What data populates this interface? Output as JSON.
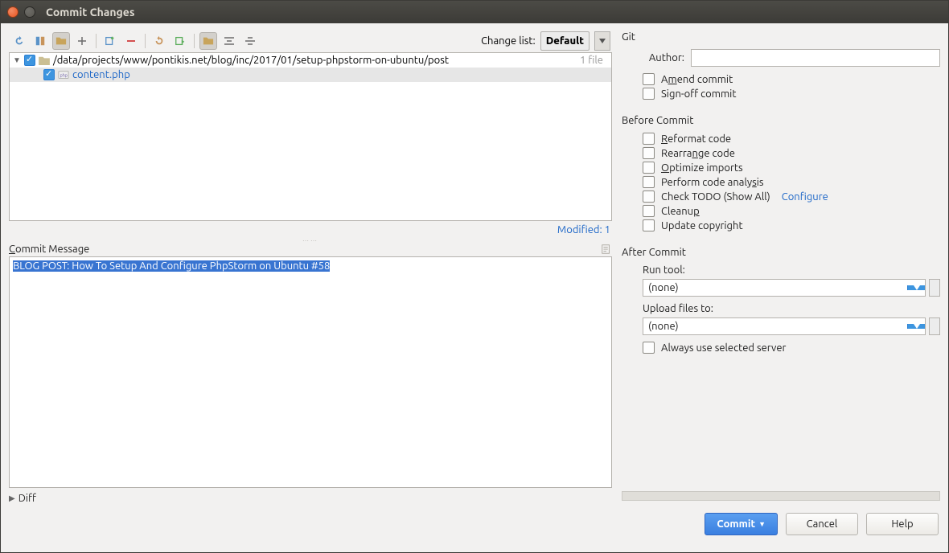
{
  "window": {
    "title": "Commit Changes"
  },
  "toolbar": {
    "change_list_label": "Change list:",
    "change_list_value": "Default"
  },
  "tree": {
    "path": "/data/projects/www/pontikis.net/blog/inc/2017/01/setup-phpstorm-on-ubuntu/post",
    "file_count": "1 file",
    "items": [
      {
        "name": "content.php",
        "checked": true
      }
    ]
  },
  "modified_label": "Modified: 1",
  "commit_message_label_pre": "C",
  "commit_message_label_rest": "ommit Message",
  "commit_message": "BLOG POST: How To Setup And Configure PhpStorm on Ubuntu #58",
  "diff_label": "Diff",
  "git": {
    "title": "Git",
    "author_label": "Author:",
    "author_value": "",
    "amend_label_pre": "A",
    "amend_label_mid": "m",
    "amend_label_rest": "end commit",
    "signoff_label": "Sign-off commit"
  },
  "before": {
    "title": "Before Commit",
    "items": [
      {
        "key": "reformat",
        "html": "<u>R</u>eformat code"
      },
      {
        "key": "rearrange",
        "html": "Rearra<u>n</u>ge code"
      },
      {
        "key": "optimize",
        "html": "<u>O</u>ptimize imports"
      },
      {
        "key": "analysis",
        "html": "Perform code analy<u>s</u>is"
      },
      {
        "key": "todo",
        "html": "Check TODO (Show All)",
        "link": "Configure"
      },
      {
        "key": "cleanup",
        "html": "Cleanu<u>p</u>"
      },
      {
        "key": "copyright",
        "html": "Update copyright"
      }
    ]
  },
  "after": {
    "title": "After Commit",
    "run_tool_label": "Run tool:",
    "run_tool_value": "(none)",
    "upload_label": "Upload files to:",
    "upload_value": "(none)",
    "always_label": "Always use selected server"
  },
  "buttons": {
    "commit": "Commit",
    "cancel": "Cancel",
    "help": "Help"
  }
}
